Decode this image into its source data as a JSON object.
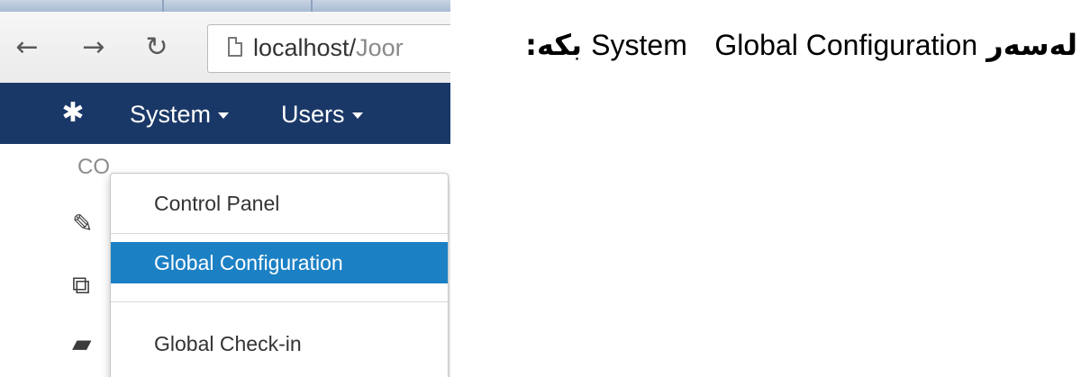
{
  "browser": {
    "url_host": "localhost/",
    "url_rest": "Joor",
    "icons": [
      "back-arrow-icon",
      "forward-arrow-icon",
      "reload-icon",
      "page-icon"
    ]
  },
  "admin_nav": {
    "logo_icon": "joomla-logo-icon",
    "menus": [
      {
        "label": "System"
      },
      {
        "label": "Users"
      }
    ],
    "background": "#1a3867"
  },
  "page": {
    "heading_partial": "CO",
    "side_icons": [
      "pencil-icon",
      "copy-icon",
      "folder-icon"
    ]
  },
  "dropdown": {
    "items": [
      {
        "label": "Control Panel",
        "active": false
      },
      {
        "label": "Global Configuration",
        "active": true
      },
      {
        "label": "Global Check-in",
        "active": false
      }
    ],
    "active_color": "#1c80c4"
  },
  "caption": {
    "prefix_ku": "لەسەر",
    "word_system": "System",
    "word_global": "Global Configuration",
    "suffix_ku": "بکە:"
  }
}
